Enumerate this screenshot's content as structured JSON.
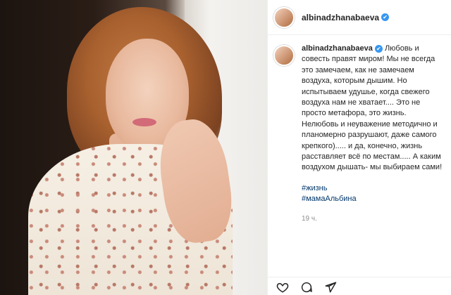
{
  "post": {
    "username": "albinadzhanabaeva",
    "verified_mark": "✔",
    "caption": "Любовь и совесть правят миром! Мы не всегда это замечаем, как не замечаем воздуха, которым дышим. Но испытываем удушье, когда свежего воздуха нам не хватает.... Это не просто метафора, это жизнь. Нелюбовь и неуважение методично и планомерно разрушают, даже самого крепкого)..... и да, конечно, жизнь расставляет всё по местам..... А каким воздухом дышать- мы выбираем сами!",
    "hashtags": [
      "#жизнь",
      "#мамаАльбина"
    ],
    "time": "19 ч."
  },
  "icons": {
    "like": "heart-icon",
    "comment": "comment-icon",
    "share": "paper-plane-icon"
  },
  "colors": {
    "hashtag": "#00376b",
    "verified": "#3897f0",
    "muted": "#8e8e8e"
  }
}
